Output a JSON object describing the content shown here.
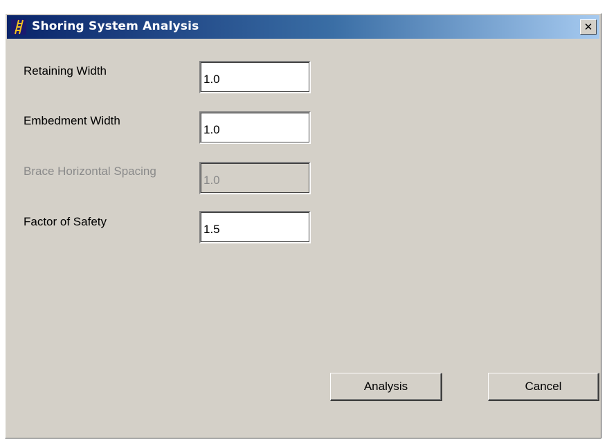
{
  "window": {
    "title": "Shoring System Analysis",
    "close_glyph": "✕",
    "app_icon": "ladder-icon",
    "titlebar_gradient": [
      "#0a246a",
      "#a6caf0"
    ],
    "face_color": "#d4d0c8"
  },
  "fields": [
    {
      "label": "Retaining Width",
      "value": "1.0",
      "enabled": true
    },
    {
      "label": "Embedment Width",
      "value": "1.0",
      "enabled": true
    },
    {
      "label": "Brace Horizontal Spacing",
      "value": "1.0",
      "enabled": false
    },
    {
      "label": "Factor of Safety",
      "value": "1.5",
      "enabled": true
    }
  ],
  "buttons": {
    "analysis_label": "Analysis",
    "cancel_label": "Cancel"
  }
}
